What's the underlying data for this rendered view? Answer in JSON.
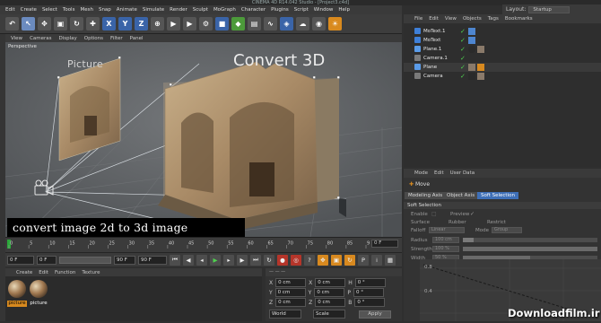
{
  "window_title": "CINEMA 4D R14.042 Studio - [Project3.c4d]",
  "menu": [
    "Edit",
    "Create",
    "Select",
    "Tools",
    "Mesh",
    "Snap",
    "Animate",
    "Simulate",
    "Render",
    "Sculpt",
    "MoGraph",
    "Character",
    "Plugins",
    "Script",
    "Window",
    "Help"
  ],
  "layout": {
    "label": "Layout:",
    "value": "Startup"
  },
  "toolbar_letters": [
    "X",
    "Y",
    "Z"
  ],
  "viewport_menu": [
    "View",
    "Cameras",
    "Display",
    "Options",
    "Filter",
    "Panel"
  ],
  "viewport_label": "Perspective",
  "scene_text": {
    "picture": "Picture",
    "convert": "Convert 3D"
  },
  "caption": "convert image 2d to 3d image",
  "timeline": {
    "ticks": [
      "0",
      "5",
      "10",
      "15",
      "20",
      "25",
      "30",
      "35",
      "40",
      "45",
      "50",
      "55",
      "60",
      "65",
      "70",
      "75",
      "80",
      "85",
      "90"
    ],
    "current_frame": "0 F"
  },
  "transport": {
    "start": "0 F",
    "min": "0 F",
    "max": "90 F",
    "end": "90 F"
  },
  "materials_menu": [
    "Create",
    "Edit",
    "Function",
    "Texture"
  ],
  "materials": [
    "picture",
    "picture"
  ],
  "coords": {
    "rows": [
      {
        "a": "X",
        "av": "0 cm",
        "b": "X",
        "bv": "0 cm",
        "c": "H",
        "cv": "0 °"
      },
      {
        "a": "Y",
        "av": "0 cm",
        "b": "Y",
        "bv": "0 cm",
        "c": "P",
        "cv": "0 °"
      },
      {
        "a": "Z",
        "av": "0 cm",
        "b": "Z",
        "bv": "0 cm",
        "c": "B",
        "cv": "0 °"
      }
    ],
    "mode1": "World",
    "mode2": "Scale",
    "apply": "Apply"
  },
  "objects_menu": [
    "File",
    "Edit",
    "View",
    "Objects",
    "Tags",
    "Bookmarks"
  ],
  "objects": [
    {
      "name": "MoText.1",
      "color": "#3e7fd8"
    },
    {
      "name": "MoText",
      "color": "#3e7fd8"
    },
    {
      "name": "Plane.1",
      "color": "#5a9be8"
    },
    {
      "name": "Camera.1",
      "color": "#7a7a7a"
    },
    {
      "name": "Plane",
      "color": "#5a9be8"
    },
    {
      "name": "Camera",
      "color": "#7a7a7a"
    }
  ],
  "attributes_menu": [
    "Mode",
    "Edit",
    "User Data"
  ],
  "attributes_title": "Move",
  "attributes_tabs": [
    "Modeling Axis",
    "Object Axis",
    "Soft Selection"
  ],
  "soft_selection": {
    "header": "Soft Selection",
    "enable": "Enable",
    "preview": "Preview",
    "surface": "Surface",
    "rubber": "Rubber",
    "restrict": "Restrict",
    "falloff": "Falloff",
    "falloff_value": "Linear",
    "mode": "Mode",
    "mode_value": "Group",
    "radius": "Radius",
    "radius_value": "100 cm",
    "strength": "Strength",
    "strength_value": "100 %",
    "width": "Width",
    "width_value": "50 %"
  },
  "graph_labels": [
    "0.8",
    "0.4"
  ],
  "watermark": "Downloadfilm.ir"
}
